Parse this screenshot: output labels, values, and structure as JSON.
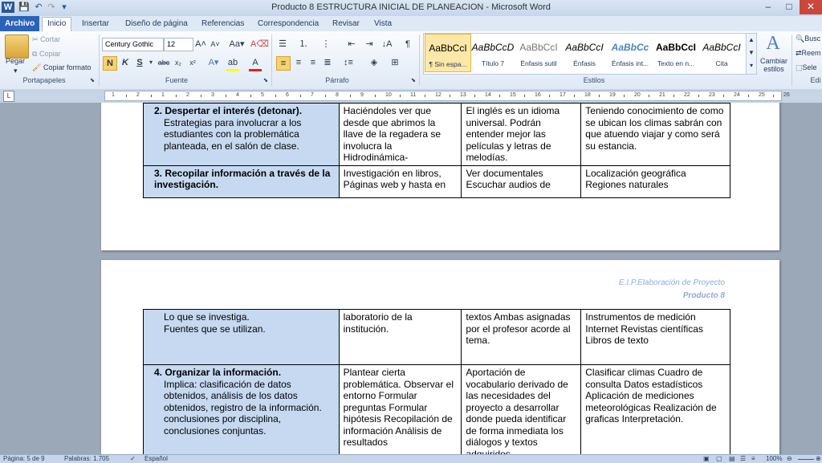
{
  "window": {
    "title": "Producto 8  ESTRUCTURA INICIAL DE PLANEACION  -  Microsoft Word",
    "app_icon": "W",
    "minimize": "–",
    "maximize": "□",
    "close": "✕"
  },
  "tabs": [
    "Archivo",
    "Inicio",
    "Insertar",
    "Diseño de página",
    "Referencias",
    "Correspondencia",
    "Revisar",
    "Vista"
  ],
  "ribbon": {
    "clipboard": {
      "paste": "Pegar",
      "cut": "Cortar",
      "copy": "Copiar",
      "format_painter": "Copiar formato",
      "label": "Portapapeles"
    },
    "font": {
      "name": "Century Gothic",
      "size": "12",
      "label": "Fuente",
      "bold": "N",
      "italic": "K",
      "underline": "S"
    },
    "paragraph": {
      "label": "Párrafo"
    },
    "styles": {
      "label": "Estilos",
      "items": [
        {
          "sample": "AaBbCcI",
          "name": "¶ Sin espa..."
        },
        {
          "sample": "AaBbCcD",
          "name": "Título 7"
        },
        {
          "sample": "AaBbCcI",
          "name": "Énfasis sutil"
        },
        {
          "sample": "AaBbCcI",
          "name": "Énfasis"
        },
        {
          "sample": "AaBbCc",
          "name": "Énfasis int..."
        },
        {
          "sample": "AaBbCcI",
          "name": "Texto en n..."
        },
        {
          "sample": "AaBbCcI",
          "name": "Cita"
        }
      ],
      "change_styles": "Cambiar estilos"
    },
    "editing": {
      "search": "Busc",
      "replace": "Reem",
      "select": "Sele",
      "label": "Edi"
    }
  },
  "ruler_numbers": [
    "1",
    "2",
    "1",
    "2",
    "3",
    "4",
    "5",
    "6",
    "7",
    "8",
    "9",
    "10",
    "11",
    "12",
    "13",
    "14",
    "15",
    "16",
    "17",
    "18",
    "19",
    "20",
    "21",
    "22",
    "23",
    "24",
    "25",
    "26"
  ],
  "page1": {
    "rows": [
      {
        "col1_title": "2. Despertar el interés (detonar).",
        "col1_body": "Estrategias para involucrar a los estudiantes con la problemática planteada, en el salón de clase.",
        "col2": "Haciéndoles ver que desde que abrimos la llave de la regadera se involucra la Hidrodinámica-",
        "col3": "El inglés es un idioma universal. Podrán entender mejor las películas y letras de melodías.",
        "col4": "Teniendo conocimiento de como se ubican los climas sabrán con que atuendo viajar y como será su estancia."
      },
      {
        "col1_title": "3. Recopilar información a través de la investigación.",
        "col2": "Investigación en libros, Páginas web y hasta en",
        "col3": "Ver documentales Escuchar audios de",
        "col4": "Localización geográfica Regiones naturales"
      }
    ]
  },
  "page2": {
    "header_line1": "E.I.P.Elaboración de Proyecto",
    "header_line2": "Producto  8",
    "rows": [
      {
        "col1_line1": "Lo que se investiga.",
        "col1_line2": "Fuentes  que se utilizan.",
        "col2": "laboratorio de la institución.",
        "col3": "textos Ambas asignadas por el profesor acorde al tema.",
        "col4": "Instrumentos de medición Internet Revistas científicas Libros de texto"
      },
      {
        "col1_title": "4. Organizar la información.",
        "col1_body": "Implica: clasificación de datos obtenidos, análisis de los datos obtenidos, registro de la información. conclusiones por disciplina, conclusiones conjuntas.",
        "col2": "Plantear cierta problemática. Observar el entorno Formular preguntas Formular hipótesis Recopilación de información Análisis de resultados",
        "col3": "Aportación de vocabulario derivado de las necesidades del proyecto a desarrollar donde pueda identificar de forma inmediata los diálogos y textos adquiridos",
        "col4": "Clasificar climas Cuadro de consulta Datos estadísticos Aplicación de mediciones meteorológicas Realización de graficas Interpretación."
      }
    ]
  },
  "status": {
    "page": "Página: 5 de 9",
    "words": "Palabras: 1.705",
    "language": "Español",
    "zoom": "100%"
  }
}
